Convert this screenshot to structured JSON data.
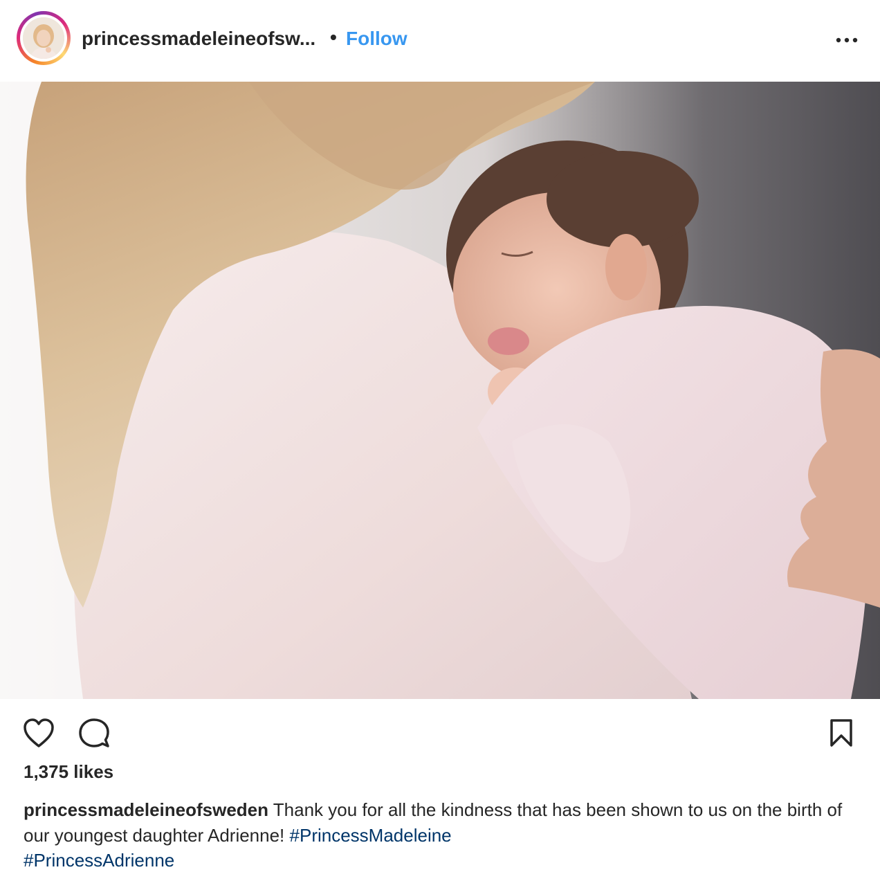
{
  "post": {
    "username": "princessmadeleineofsw...",
    "separator": "•",
    "follow_label": "Follow",
    "more_icon": "more-options-icon"
  },
  "actions": {
    "like_icon": "heart-icon",
    "comment_icon": "comment-icon",
    "save_icon": "bookmark-icon"
  },
  "likes": "1,375 likes",
  "caption": {
    "username": "princessmadeleineofsweden",
    "text": "Thank you for all the kindness that has been shown to us on the birth of our youngest daughter Adrienne!",
    "hashtags": [
      "#PrincessMadeleine",
      "#PrincessAdrienne"
    ]
  },
  "colors": {
    "link_blue": "#3897f0",
    "hashtag_blue": "#003569",
    "text": "#262626"
  }
}
